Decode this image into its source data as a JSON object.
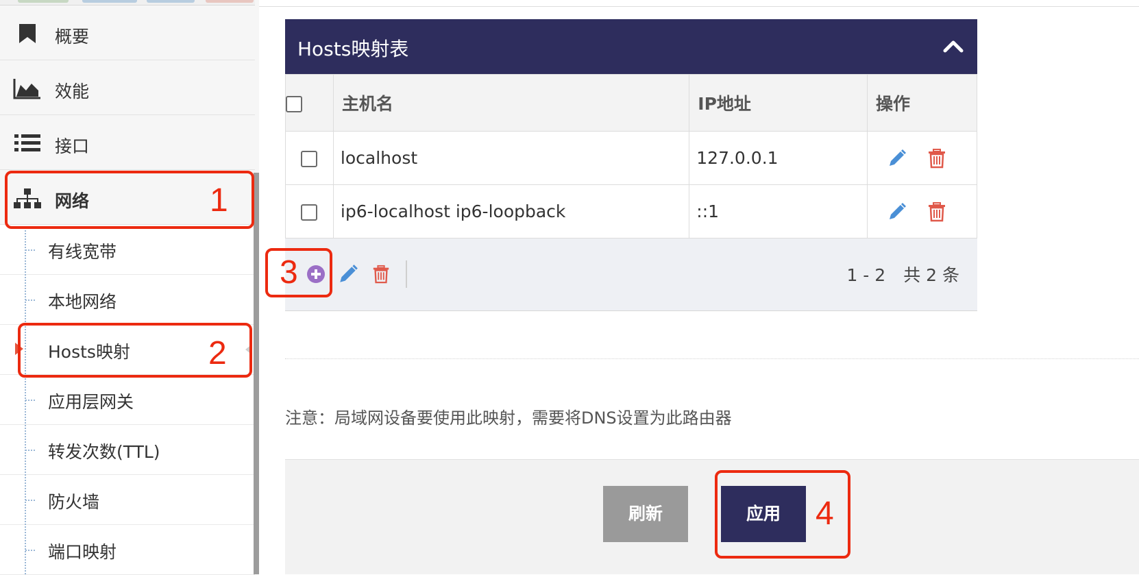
{
  "sidebar": {
    "main_items": [
      {
        "label": "概要",
        "icon": "bookmark-icon"
      },
      {
        "label": "效能",
        "icon": "area-chart-icon"
      },
      {
        "label": "接口",
        "icon": "list-icon"
      },
      {
        "label": "网络",
        "icon": "network-icon"
      }
    ],
    "sub_items": [
      {
        "label": "有线宽带"
      },
      {
        "label": "本地网络"
      },
      {
        "label": "Hosts映射"
      },
      {
        "label": "应用层网关"
      },
      {
        "label": "转发次数(TTL)"
      },
      {
        "label": "防火墙"
      },
      {
        "label": "端口映射"
      }
    ]
  },
  "panel": {
    "title": "Hosts映射表",
    "collapse_icon": "chevron-up-icon",
    "columns": [
      "主机名",
      "IP地址",
      "操作"
    ],
    "rows": [
      {
        "hostname": "localhost",
        "ip": "127.0.0.1"
      },
      {
        "hostname": "ip6-localhost ip6-loopback",
        "ip": "::1"
      }
    ],
    "pager": {
      "range": "1 - 2",
      "total": "共 2 条"
    }
  },
  "note": "注意：局域网设备要使用此映射，需要将DNS设置为此路由器",
  "footer": {
    "refresh_label": "刷新",
    "apply_label": "应用"
  },
  "callouts": [
    "1",
    "2",
    "3",
    "4"
  ],
  "colors": {
    "accent": "#2e2d5d",
    "callout": "#ec2a10",
    "edit": "#4a8fd6",
    "delete": "#e0594a",
    "add": "#9b6fc6"
  }
}
